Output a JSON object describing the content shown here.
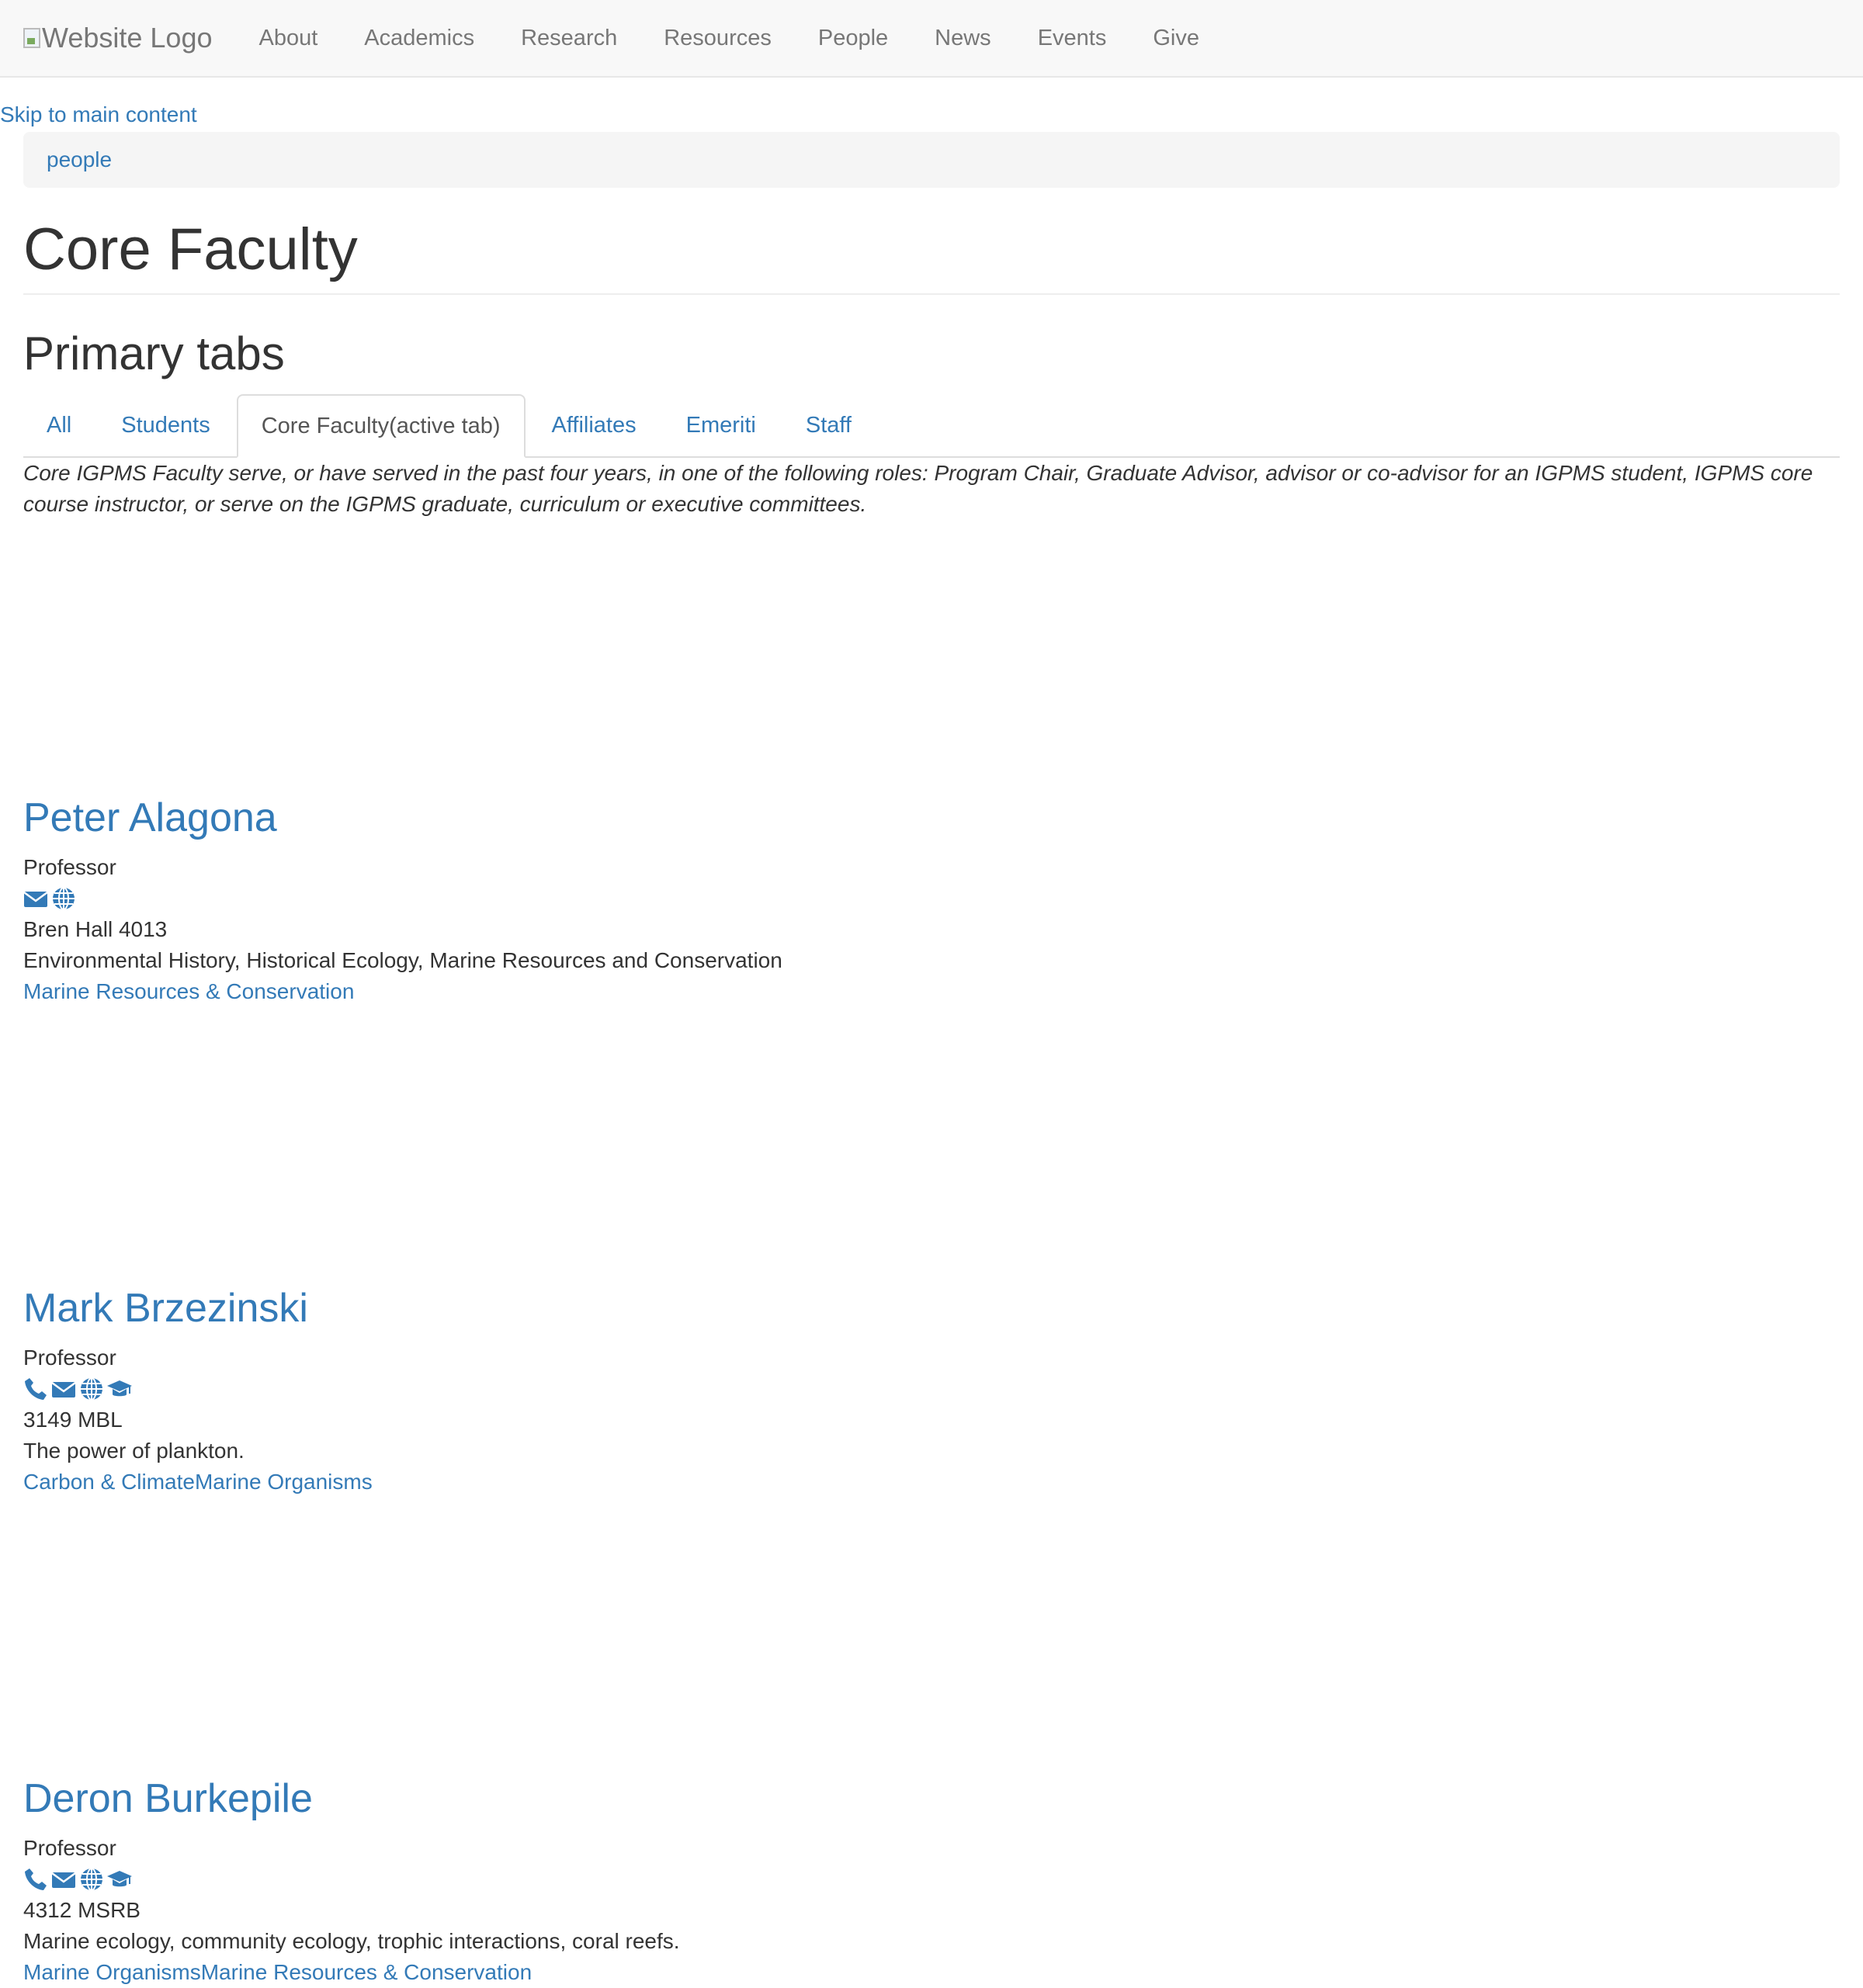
{
  "header": {
    "logo_alt": "Website Logo",
    "nav": [
      "About",
      "Academics",
      "Research",
      "Resources",
      "People",
      "News",
      "Events",
      "Give"
    ]
  },
  "skip_link": "Skip to main content",
  "breadcrumb": [
    "people"
  ],
  "page_title": "Core Faculty",
  "tabs_heading": "Primary tabs",
  "tabs": [
    "All",
    "Students",
    "Core Faculty(active tab)",
    "Affiliates",
    "Emeriti",
    "Staff"
  ],
  "active_tab": "Core Faculty(active tab)",
  "intro": "Core IGPMS Faculty serve, or have served in the past four years, in one of the following roles: Program Chair, Graduate Advisor, advisor or co-advisor for an IGPMS student, IGPMS core course instructor, or serve on the IGPMS graduate, curriculum or executive committees.",
  "people": [
    {
      "name": "Peter Alagona",
      "title": "Professor",
      "icons": [
        "envelope-icon",
        "globe-icon"
      ],
      "office": "Bren Hall 4013",
      "research": "Environmental History, Historical Ecology, Marine Resources and Conservation",
      "tags": [
        "Marine Resources & Conservation"
      ]
    },
    {
      "name": "Mark Brzezinski",
      "title": "Professor",
      "icons": [
        "phone-icon",
        "envelope-icon",
        "globe-icon",
        "graduation-cap-icon"
      ],
      "office": "3149 MBL",
      "research": "The power of plankton.",
      "tags": [
        "Carbon & Climate",
        "Marine Organisms"
      ]
    },
    {
      "name": "Deron Burkepile",
      "title": "Professor",
      "icons": [
        "phone-icon",
        "envelope-icon",
        "globe-icon",
        "graduation-cap-icon"
      ],
      "office": "4312 MSRB",
      "research": "Marine ecology, community ecology, trophic interactions, coral reefs.",
      "tags": [
        "Marine Organisms",
        "Marine Resources & Conservation"
      ]
    }
  ]
}
